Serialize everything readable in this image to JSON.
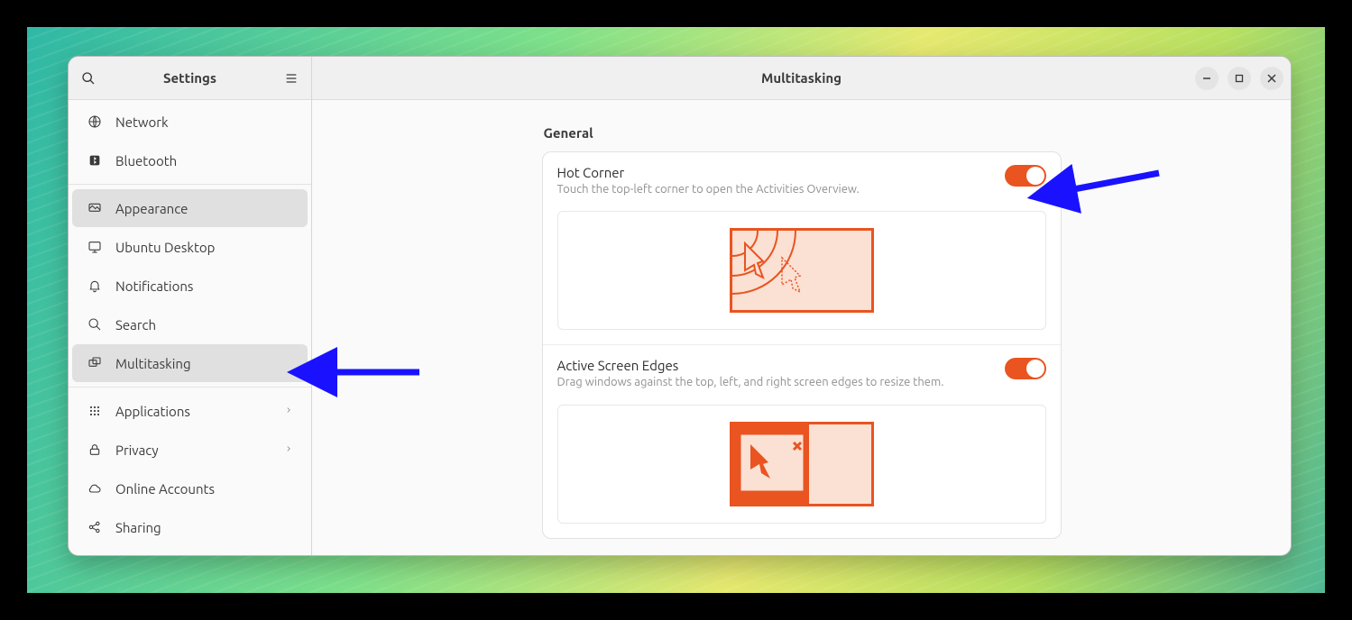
{
  "sidebar": {
    "title": "Settings",
    "groups": [
      {
        "items": [
          {
            "id": "network",
            "label": "Network"
          },
          {
            "id": "bluetooth",
            "label": "Bluetooth"
          }
        ]
      },
      {
        "items": [
          {
            "id": "appearance",
            "label": "Appearance"
          },
          {
            "id": "ubuntu-desktop",
            "label": "Ubuntu Desktop"
          },
          {
            "id": "notifications",
            "label": "Notifications"
          },
          {
            "id": "search",
            "label": "Search"
          },
          {
            "id": "multitasking",
            "label": "Multitasking",
            "selected": true
          }
        ]
      },
      {
        "items": [
          {
            "id": "applications",
            "label": "Applications",
            "chevron": true
          },
          {
            "id": "privacy",
            "label": "Privacy",
            "chevron": true
          },
          {
            "id": "online-accounts",
            "label": "Online Accounts"
          },
          {
            "id": "sharing",
            "label": "Sharing"
          }
        ]
      }
    ]
  },
  "main": {
    "title": "Multitasking",
    "section": "General",
    "hot_corner": {
      "title": "Hot Corner",
      "desc": "Touch the top-left corner to open the Activities Overview.",
      "enabled": true
    },
    "active_edges": {
      "title": "Active Screen Edges",
      "desc": "Drag windows against the top, left, and right screen edges to resize them.",
      "enabled": true
    }
  },
  "colors": {
    "accent": "#e95420",
    "arrow": "#1a12ff"
  }
}
